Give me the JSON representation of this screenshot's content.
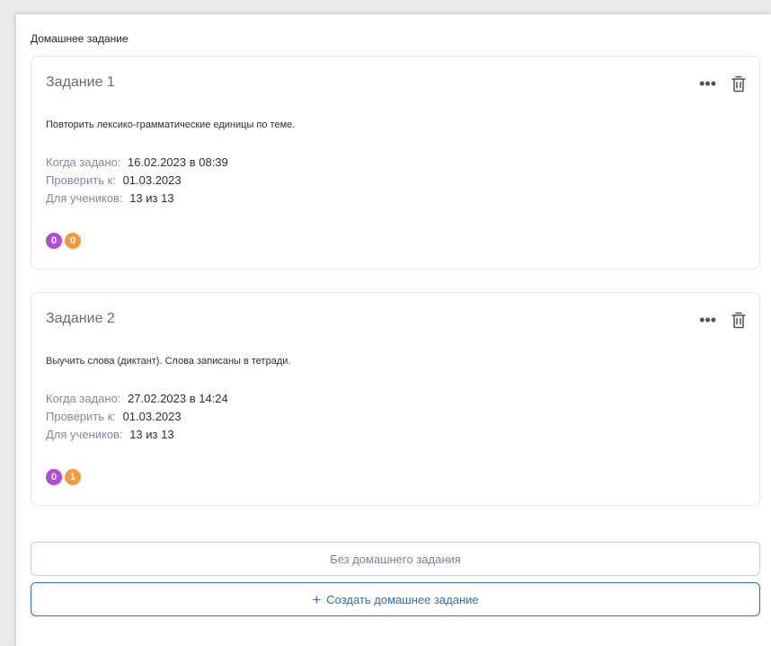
{
  "section": {
    "title": "Домашнее задание"
  },
  "tasks": [
    {
      "title": "Задание 1",
      "description": "Повторить лексико-грамматические единицы по теме.",
      "assigned_label": "Когда задано:",
      "assigned_value": "16.02.2023 в 08:39",
      "check_label": "Проверить к:",
      "check_value": "01.03.2023",
      "students_label": "Для учеников:",
      "students_value": "13 из 13",
      "badge_purple": "0",
      "badge_orange": "0"
    },
    {
      "title": "Задание 2",
      "description": "Выучить слова (диктант). Слова записаны в тетради.",
      "assigned_label": "Когда задано:",
      "assigned_value": "27.02.2023 в 14:24",
      "check_label": "Проверить к:",
      "check_value": "01.03.2023",
      "students_label": "Для учеников:",
      "students_value": "13 из 13",
      "badge_purple": "0",
      "badge_orange": "1"
    }
  ],
  "buttons": {
    "no_homework": "Без домашнего задания",
    "create_plus": "+",
    "create": "Создать домашнее задание"
  },
  "icons": {
    "more": "more-horizontal-icon",
    "delete": "trash-icon",
    "add": "plus-icon"
  },
  "colors": {
    "accent": "#2f6fc5",
    "badge_purple": "#b24bd6",
    "badge_orange": "#f19a3e",
    "label": "#7f8aa3"
  }
}
